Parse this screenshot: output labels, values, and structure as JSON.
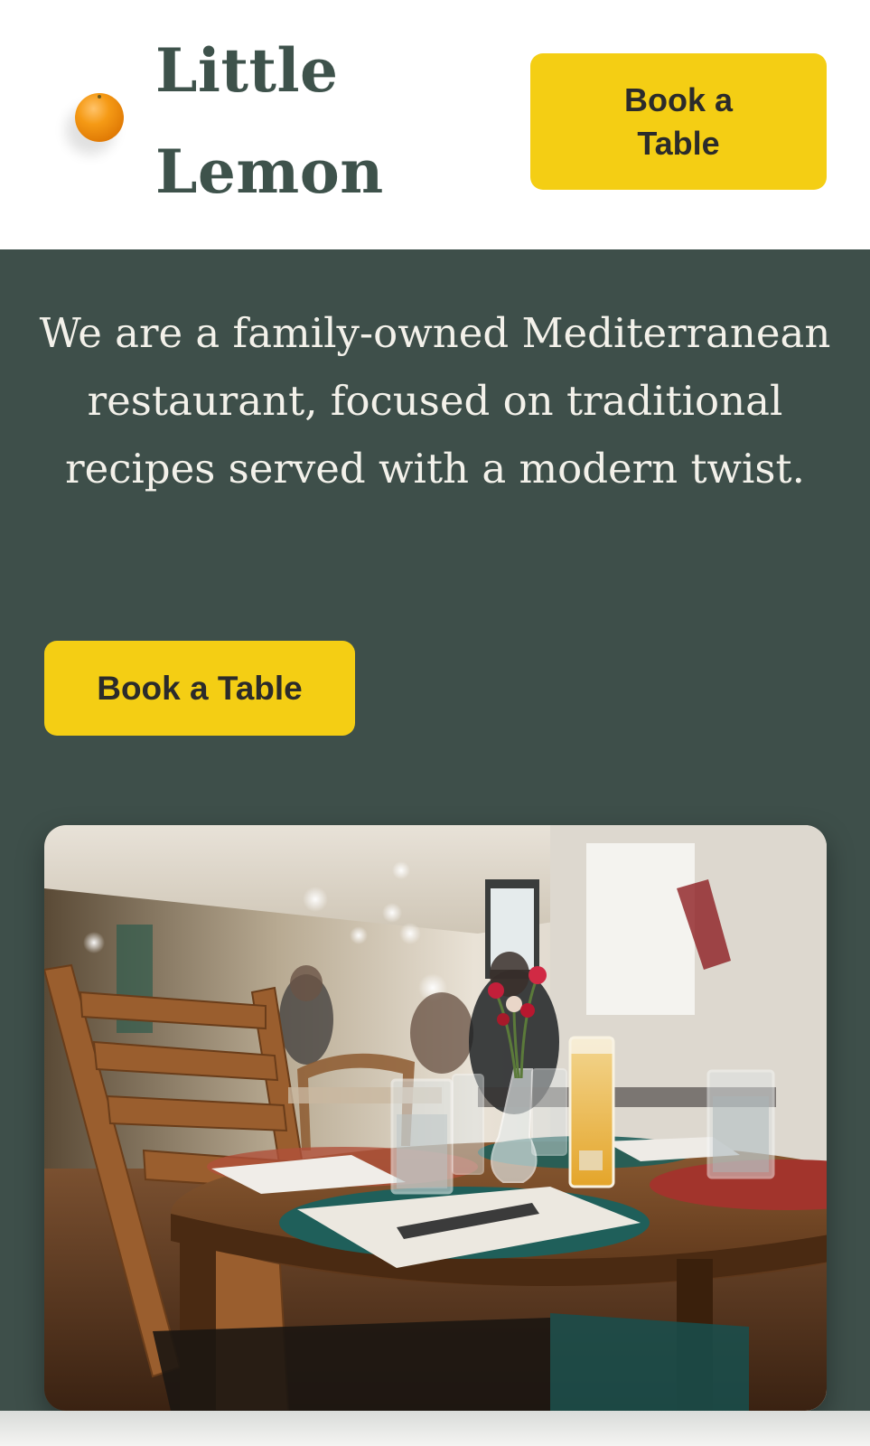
{
  "header": {
    "brand_line1": "Little",
    "brand_line2": "Lemon",
    "logo_icon": "lemon-icon",
    "book_button_label": "Book a Table"
  },
  "hero": {
    "tagline": "We are a family-owned Mediterranean restaurant, focused on traditional recipes served with a modern twist.",
    "book_button_label": "Book a Table",
    "photo_icon": "restaurant-photo"
  },
  "colors": {
    "primary_green": "#3e4f4a",
    "accent_yellow": "#f4ce14",
    "brand_text": "#3e524b",
    "hero_text": "#f3f1ea"
  }
}
